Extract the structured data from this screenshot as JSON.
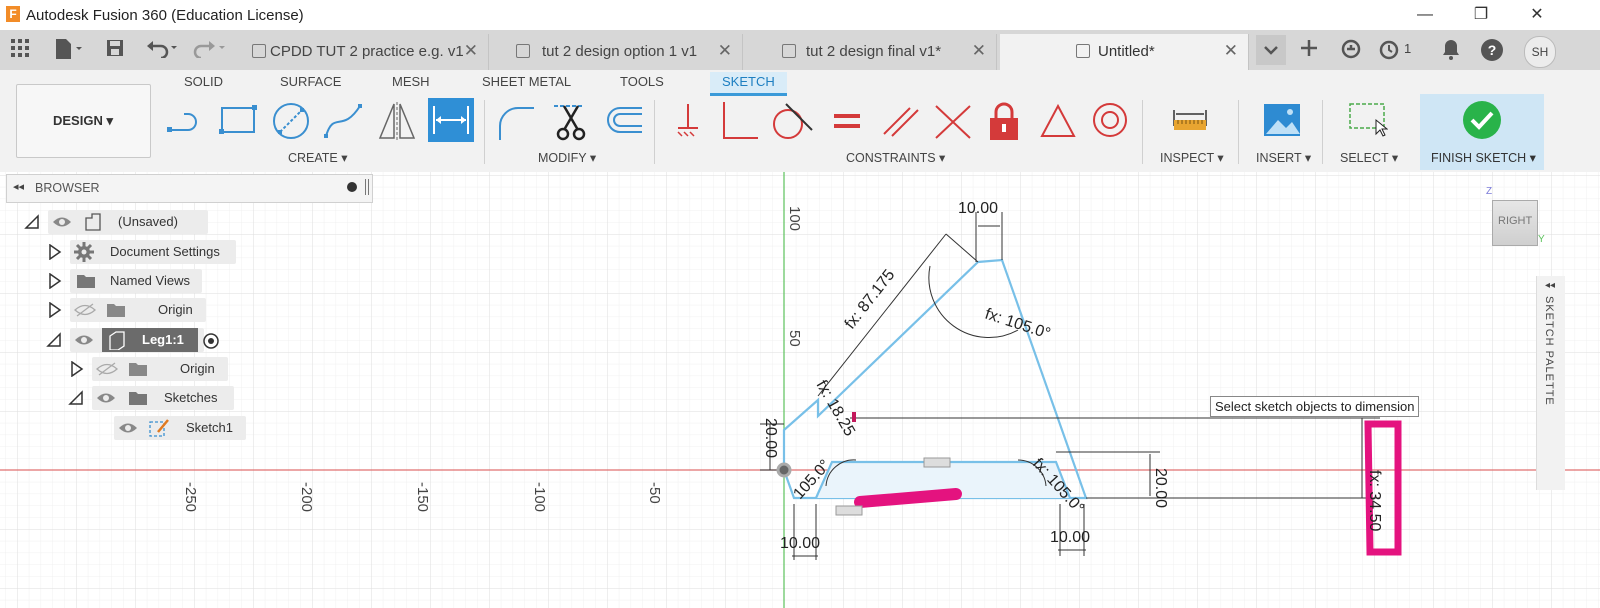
{
  "window": {
    "title": "Autodesk Fusion 360 (Education License)",
    "logo": "F"
  },
  "window_controls": {
    "minimize": "—",
    "restore": "❐",
    "close": "✕"
  },
  "toolbar_icons": [
    "grid-icon",
    "file-icon",
    "save-icon",
    "undo-icon",
    "redo-icon"
  ],
  "tabs": [
    {
      "label": "CPDD TUT 2 practice e.g. v1",
      "active": false
    },
    {
      "label": "tut 2 design option 1 v1",
      "active": false
    },
    {
      "label": "tut 2 design final v1*",
      "active": false
    },
    {
      "label": "Untitled*",
      "active": true
    }
  ],
  "tabbar_right": {
    "jobs_count": "1",
    "user_initials": "SH"
  },
  "ribbon": {
    "tabs": [
      "SOLID",
      "SURFACE",
      "MESH",
      "SHEET METAL",
      "TOOLS",
      "SKETCH"
    ],
    "active_tab": "SKETCH",
    "workspace": "DESIGN ▾",
    "groups": {
      "create": "CREATE ▾",
      "modify": "MODIFY ▾",
      "constraints": "CONSTRAINTS ▾",
      "inspect": "INSPECT ▾",
      "insert": "INSERT ▾",
      "select": "SELECT ▾",
      "finish": "FINISH SKETCH ▾"
    }
  },
  "browser": {
    "header": "BROWSER",
    "items": [
      {
        "label": "(Unsaved)",
        "level": 0,
        "expanded": true
      },
      {
        "label": "Document Settings",
        "level": 1,
        "expanded": false
      },
      {
        "label": "Named Views",
        "level": 1,
        "expanded": false
      },
      {
        "label": "Origin",
        "level": 1,
        "expanded": false
      },
      {
        "label": "Leg1:1",
        "level": 1,
        "expanded": true
      },
      {
        "label": "Origin",
        "level": 2,
        "expanded": false
      },
      {
        "label": "Sketches",
        "level": 2,
        "expanded": true
      },
      {
        "label": "Sketch1",
        "level": 3,
        "expanded": false
      }
    ]
  },
  "canvas": {
    "x_ticks": [
      "-250",
      "-200",
      "-150",
      "-100",
      "-50"
    ],
    "y_ticks": [
      "100",
      "50"
    ],
    "dimensions": {
      "top_width": "10.00",
      "left_slant": "fx: 87.175",
      "top_angle": "fx: 105.0°",
      "left_small": "fx: 18.25",
      "left_height": "20.00",
      "bottom_left_angle": "105.0°",
      "bottom_right_angle": "fx: 105.0°",
      "right_height": "20.00",
      "far_right": "fx: 34.50",
      "bottom_left_width": "10.00",
      "bottom_right_width": "10.00"
    },
    "tooltip": "Select sketch objects to dimension",
    "viewcube": {
      "face": "RIGHT",
      "z_label": "Z",
      "y_label": "Y"
    },
    "sketch_palette": "SKETCH PALETTE"
  },
  "colors": {
    "accent": "#3a9ad9",
    "sketch_line": "#78c0e8",
    "axis_red": "#e07070",
    "axis_green": "#5cc25c",
    "markup": "#e4137f",
    "finish_green": "#29b34a"
  }
}
